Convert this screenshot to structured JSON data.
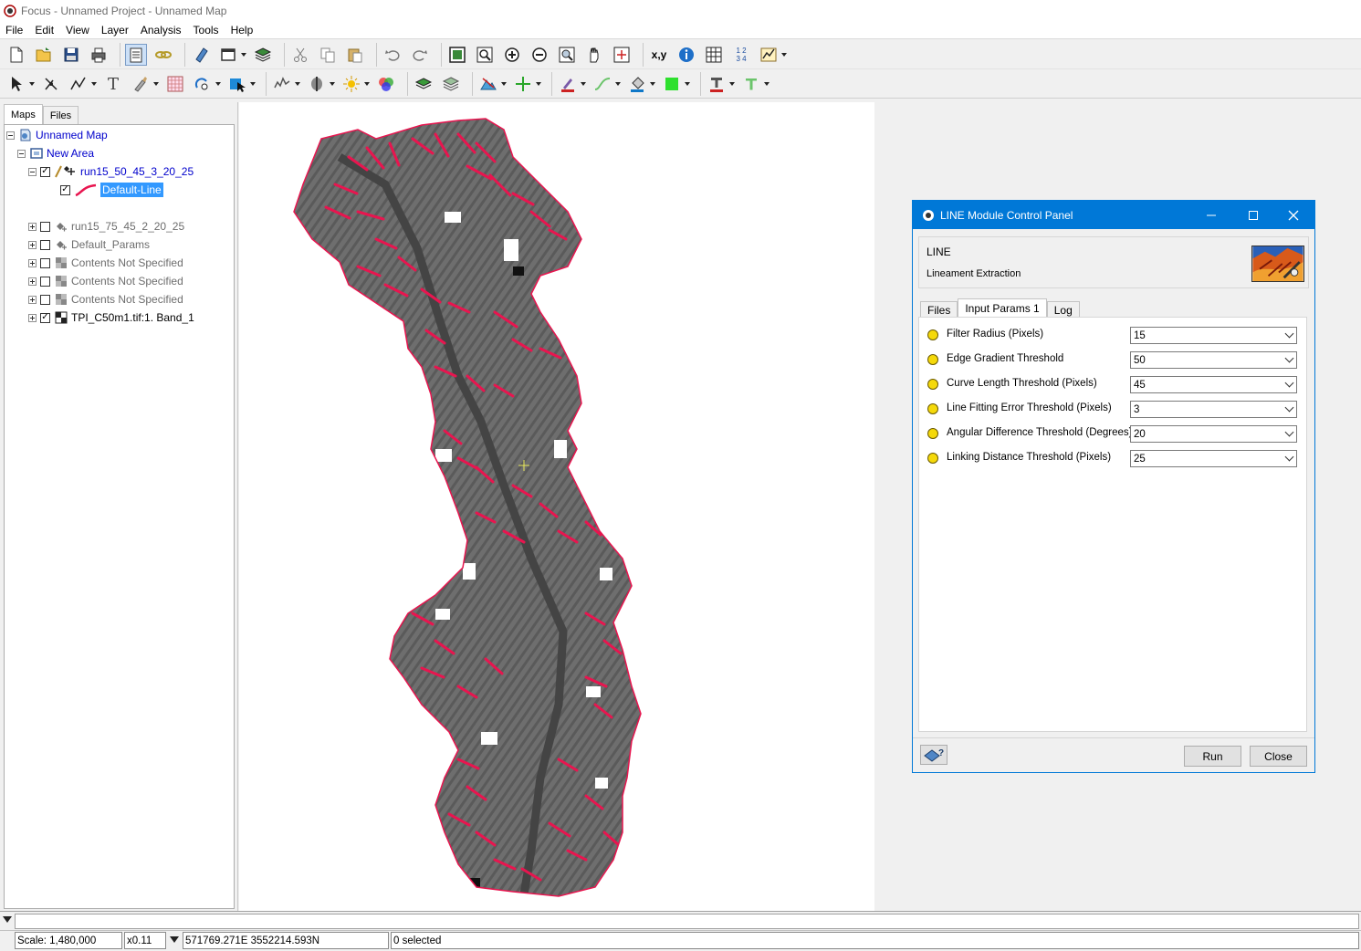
{
  "window": {
    "title": "Focus - Unnamed Project - Unnamed Map"
  },
  "menu": [
    "File",
    "Edit",
    "View",
    "Layer",
    "Analysis",
    "Tools",
    "Help"
  ],
  "toolbar": {
    "xy_label": "x,y",
    "numbers_label": "1 2 3 4",
    "text_tool_label": "T"
  },
  "left_panel": {
    "tabs": [
      "Maps",
      "Files"
    ],
    "tree": {
      "map": "Unnamed Map",
      "area": "New Area",
      "layer1": "run15_50_45_3_20_25",
      "layer1_child": "Default-Line",
      "layer2": "run15_75_45_2_20_25",
      "layer3": "Default_Params",
      "layer4": "Contents Not Specified",
      "layer5": "Contents Not Specified",
      "layer6": "Contents Not Specified",
      "layer7": "TPI_C50m1.tif:1. Band_1"
    }
  },
  "dialog": {
    "title": "LINE Module Control Panel",
    "module_name": "LINE",
    "module_description": "Lineament Extraction",
    "tabs": [
      "Files",
      "Input Params 1",
      "Log"
    ],
    "active_tab": "Input Params 1",
    "params": [
      {
        "label": "Filter Radius (Pixels)",
        "value": "15"
      },
      {
        "label": "Edge Gradient Threshold",
        "value": "50"
      },
      {
        "label": "Curve Length Threshold (Pixels)",
        "value": "45"
      },
      {
        "label": "Line Fitting Error Threshold (Pixels)",
        "value": "3"
      },
      {
        "label": "Angular Difference Threshold (Degrees)",
        "value": "20"
      },
      {
        "label": "Linking Distance Threshold (Pixels)",
        "value": "25"
      }
    ],
    "run_label": "Run",
    "close_label": "Close"
  },
  "status": {
    "scale": "Scale: 1,480,000",
    "zoom": "x0.11",
    "coords": "571769.271E 3552214.593N",
    "selection": "0 selected"
  },
  "colors": {
    "accent": "#0078d7",
    "lineament": "#e8154f",
    "raster_gray": "#6e6e6e",
    "tree_link": "#0000cc"
  }
}
